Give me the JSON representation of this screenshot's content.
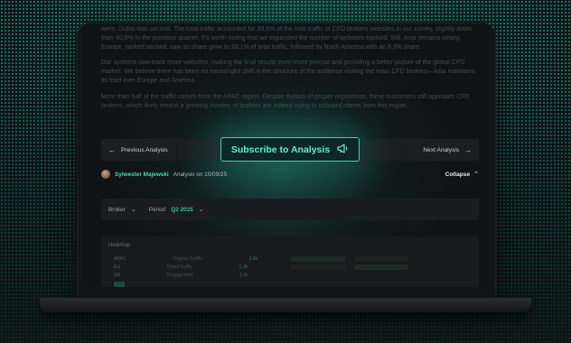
{
  "article": {
    "paragraphs": [
      "were, Dubai was second. The total traffic accounted for 39.6% of the total traffic of CFD brokers websites in our survey, slightly down from 40.6% in the previous quarter. It's worth noting that we expanded the number of websites tracked. Still, Asia remains strong. Europe, ranked second, saw its share grow to 28.1% of total traffic, followed by North America with an 8.3% share.",
      "Our systems now track more websites, making the final results even more precise and providing a better picture of the global CFD market. We believe there has been no meaningful shift in the structure of the audience visiting the main CFD brokers—Asia maintains its lead over Europe and America.",
      "More than half of the traffic comes from the APAC region. Despite thelack of proper regulations, these customers still approach CFD brokers, which likely means a growing number of brokers are indeed trying to onboard clients from this region."
    ]
  },
  "nav": {
    "prev_label": "Previous Analysis",
    "next_label": "Next Analysis",
    "subscribe_label": "Subscribe to Analysis",
    "prev_icon": "arrow-left-icon",
    "next_icon": "arrow-right-icon",
    "subscribe_icon": "megaphone-icon"
  },
  "author": {
    "name": "Sylwester Majewski",
    "meta": "Analysis on 10/09/25",
    "collapse_label": "Collapse"
  },
  "filters": {
    "broker_label": "Broker",
    "period_label": "Period",
    "period_value": "Q2 2025"
  },
  "heatmap": {
    "title": "Heatmap",
    "rows": [
      {
        "region": "APAC",
        "metric": "Organic Traffic",
        "value": "3.8k"
      },
      {
        "region": "EU",
        "metric": "Direct Traffic",
        "value": "2.4k"
      },
      {
        "region": "NA",
        "metric": "Engagement",
        "value": "1.1k"
      }
    ]
  },
  "colors": {
    "accent": "#39d6b3",
    "background": "#0c1616",
    "panel": "#1b1f21"
  }
}
